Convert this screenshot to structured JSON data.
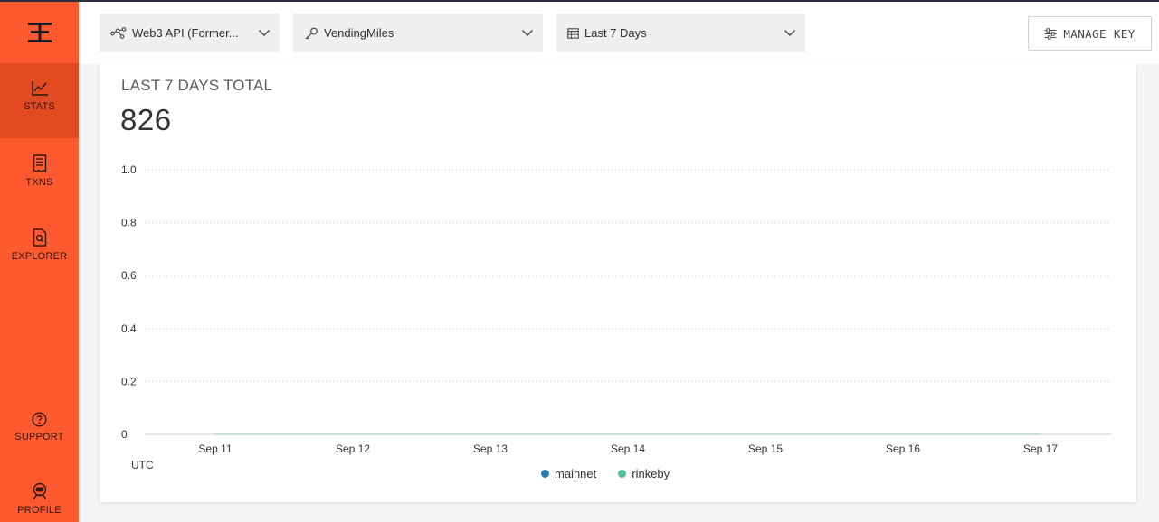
{
  "sidebar": {
    "items": [
      {
        "label": "STATS",
        "active": true
      },
      {
        "label": "TXNS",
        "active": false
      },
      {
        "label": "EXPLORER",
        "active": false
      },
      {
        "label": "SUPPORT",
        "active": false
      },
      {
        "label": "PROFILE",
        "active": false
      }
    ],
    "colors": {
      "background": "#ff5a2f",
      "active": "#e24a22"
    }
  },
  "header": {
    "project_select": {
      "value": "Web3 API (Former...",
      "icon": "network-icon"
    },
    "key_select": {
      "value": "VendingMiles",
      "icon": "key-icon"
    },
    "range_select": {
      "value": "Last 7 Days",
      "icon": "calendar-icon"
    },
    "manage_key_label": "MANAGE KEY"
  },
  "card": {
    "title": "LAST 7 DAYS TOTAL",
    "total": "826",
    "utc_label": "UTC"
  },
  "chart_data": {
    "type": "line",
    "categories": [
      "Sep 11",
      "Sep 12",
      "Sep 13",
      "Sep 14",
      "Sep 15",
      "Sep 16",
      "Sep 17"
    ],
    "series": [
      {
        "name": "mainnet",
        "color": "#2b7bb9",
        "values": [
          0,
          0,
          0,
          0,
          0,
          0,
          0
        ]
      },
      {
        "name": "rinkeby",
        "color": "#4fc1a0",
        "values": [
          0,
          0,
          0,
          0,
          0,
          0,
          0
        ]
      }
    ],
    "yticks": [
      "0",
      "0.2",
      "0.4",
      "0.6",
      "0.8",
      "1.0"
    ],
    "ylim": [
      0,
      1
    ],
    "grid": true,
    "legend_position": "bottom"
  }
}
